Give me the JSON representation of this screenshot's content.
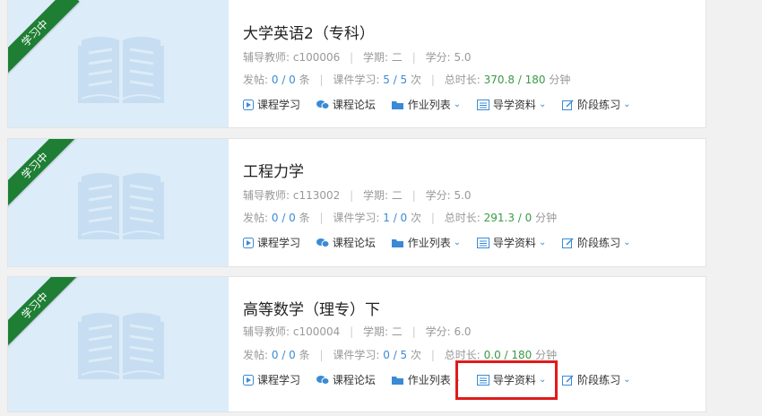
{
  "courses": [
    {
      "badge": "学习中",
      "title": "大学英语2（专科）",
      "teacher_label": "辅导教师:",
      "teacher": "c100006",
      "term_label": "学期:",
      "term": "二",
      "credit_label": "学分:",
      "credit": "5.0",
      "posts_label": "发帖:",
      "posts": "0 / 0",
      "posts_unit": "条",
      "courseware_label": "课件学习:",
      "courseware": "5 / 5",
      "courseware_unit": "次",
      "duration_label": "总时长:",
      "duration": "370.8 / 180",
      "duration_unit": "分钟"
    },
    {
      "badge": "学习中",
      "title": "工程力学",
      "teacher_label": "辅导教师:",
      "teacher": "c113002",
      "term_label": "学期:",
      "term": "二",
      "credit_label": "学分:",
      "credit": "5.0",
      "posts_label": "发帖:",
      "posts": "0 / 0",
      "posts_unit": "条",
      "courseware_label": "课件学习:",
      "courseware": "1 / 0",
      "courseware_unit": "次",
      "duration_label": "总时长:",
      "duration": "291.3 / 0",
      "duration_unit": "分钟"
    },
    {
      "badge": "学习中",
      "title": "高等数学（理专）下",
      "teacher_label": "辅导教师:",
      "teacher": "c100004",
      "term_label": "学期:",
      "term": "二",
      "credit_label": "学分:",
      "credit": "6.0",
      "posts_label": "发帖:",
      "posts": "0 / 0",
      "posts_unit": "条",
      "courseware_label": "课件学习:",
      "courseware": "0 / 5",
      "courseware_unit": "次",
      "duration_label": "总时长:",
      "duration": "0.0 / 180",
      "duration_unit": "分钟"
    }
  ],
  "actions": {
    "course_study": "课程学习",
    "course_forum": "课程论坛",
    "homework_list": "作业列表",
    "guide_materials": "导学资料",
    "stage_practice": "阶段练习"
  },
  "colors": {
    "ribbon": "#1e7e34",
    "accent": "#3a8ad6",
    "duration": "#3a9a46",
    "highlight": "#e01b1b"
  }
}
